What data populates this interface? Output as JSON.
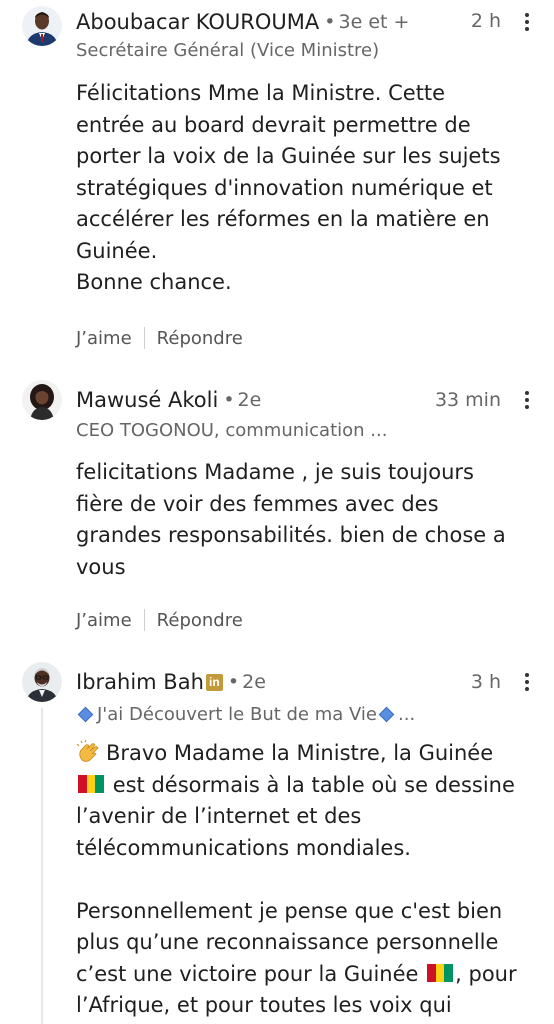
{
  "comments": [
    {
      "name": "Aboubacar KOUROUMA",
      "degree": "3e et +",
      "time": "2 h",
      "headline": "Secrétaire Général (Vice Ministre)",
      "body_lines": [
        "Félicitations Mme la Ministre. Cette",
        "entrée au board devrait permettre de",
        "porter la voix de la Guinée sur les sujets",
        "stratégiques d'innovation numérique et",
        "accélérer les réformes en la matière en",
        "Guinée.",
        "Bonne chance."
      ],
      "like_label": "J’aime",
      "reply_label": "Répondre"
    },
    {
      "name": "Mawusé Akoli",
      "degree": "2e",
      "time": "33 min",
      "headline": "CEO TOGONOU, communication ...",
      "body_lines": [
        "felicitations Madame , je suis toujours",
        "fière de voir des femmes avec des",
        "grandes responsabilités. bien de chose a",
        "vous"
      ],
      "like_label": "J’aime",
      "reply_label": "Répondre"
    },
    {
      "name": "Ibrahim Bah",
      "badge": "in",
      "degree": "2e",
      "time": "3 h",
      "headline": "J'ai Découvert le But de ma Vie",
      "headline_suffix": "...",
      "body": {
        "line1": "Bravo Madame la Ministre, la Guinée",
        "line2": "est désormais à la table où se dessine",
        "line3": "l’avenir de l’internet et des",
        "line4": "télécommunications mondiales.",
        "line6": "Personnellement je pense que c'est bien",
        "line7": "plus qu’une reconnaissance personnelle",
        "line8a": "c’est une victoire pour la Guinée",
        "line8b": ", pour",
        "line9": "l’Afrique, et pour toutes les voix qui"
      }
    }
  ],
  "colors": {
    "text": "#1f1f1f",
    "secondary": "#666666",
    "guinea_flag": [
      "#ce1126",
      "#fcd116",
      "#009460"
    ],
    "linkedin_badge": "#c39a3a",
    "diamond": "#5a8ee0"
  },
  "icons": [
    "more-vertical-icon",
    "linkedin-badge-icon",
    "diamond-icon",
    "clapping-hands-icon",
    "guinea-flag-icon"
  ]
}
